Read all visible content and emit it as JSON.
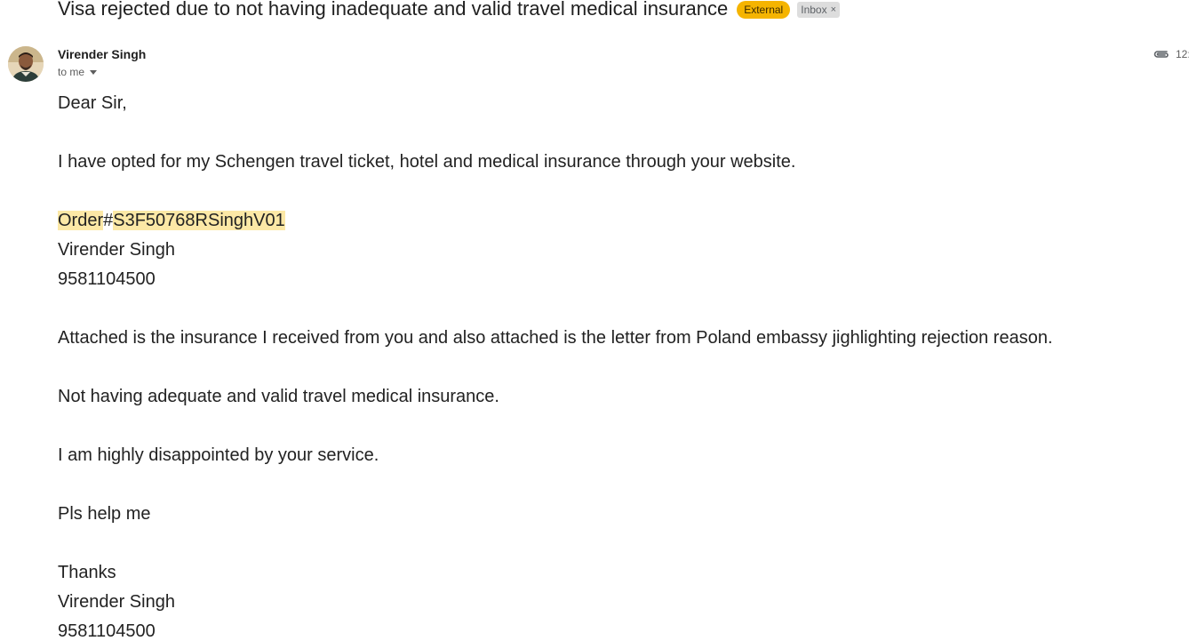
{
  "email": {
    "subject": "Visa rejected due to not having inadequate and valid travel medical insurance",
    "labels": {
      "external": "External",
      "inbox": "Inbox",
      "inbox_remove": "×"
    },
    "sender": {
      "name": "Virender Singh",
      "to": "to me",
      "time": "12:"
    },
    "body": {
      "greeting": "Dear Sir,",
      "intro": "I have opted for my Schengen travel ticket, hotel and medical insurance through your website.",
      "order_word": "Order",
      "order_hash": "#",
      "order_id": "S3F50768RSinghV01",
      "name_line": "Virender Singh",
      "phone_line": "9581104500",
      "attached": "Attached is the insurance I received from you and also attached is the letter from Poland embassy jighlighting rejection reason.",
      "reason": "Not having adequate and valid travel medical insurance.",
      "disappointed": "I am highly disappointed by your service.",
      "help": "Pls help me",
      "thanks": "Thanks",
      "sign_name": "Virender Singh",
      "sign_phone": "9581104500"
    }
  },
  "colors": {
    "external_chip": "#f5b400",
    "inbox_chip": "#dddddd",
    "highlight": "#fce8a6"
  },
  "icons": {
    "attachment": "paperclip-icon",
    "caret": "chevron-down-icon",
    "avatar": "sender-avatar"
  }
}
